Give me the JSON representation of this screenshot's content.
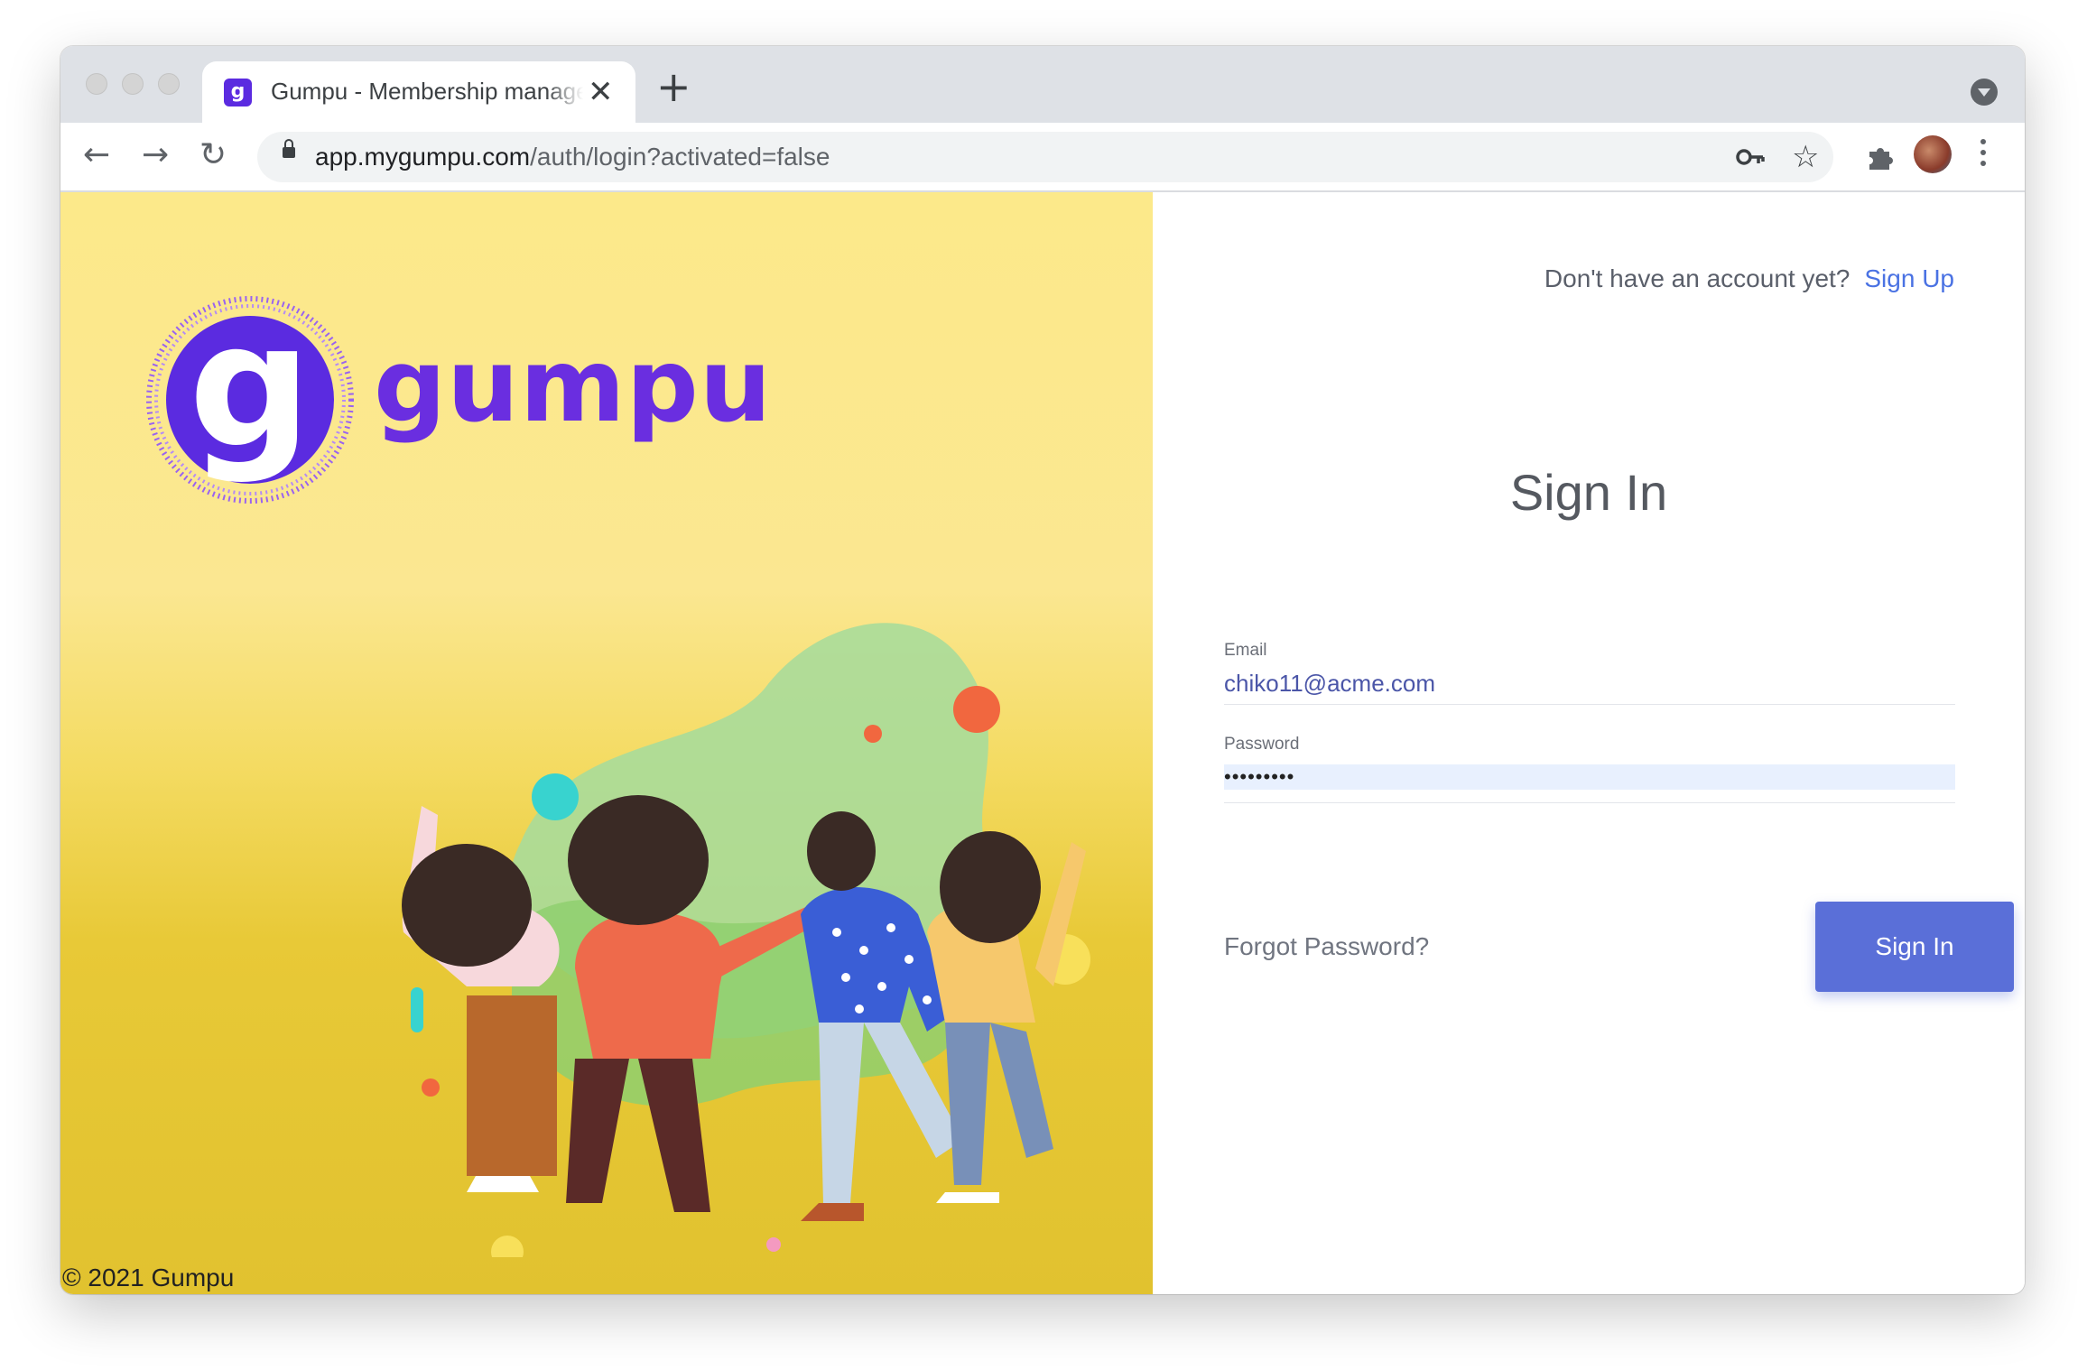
{
  "browser": {
    "tab_title": "Gumpu - Membership management",
    "tab_favicon": "g",
    "new_tab": "+",
    "close_tab": "✕",
    "url_host": "app.mygumpu.com",
    "url_path": "/auth/login?activated=false"
  },
  "icons": {
    "back": "back-arrow-icon",
    "forward": "forward-arrow-icon",
    "reload": "reload-icon",
    "key": "key-icon",
    "star": "star-icon",
    "extensions": "puzzle-icon",
    "menu": "kebab-menu-icon"
  },
  "brand": {
    "logo_letter": "g",
    "name": "gumpu",
    "color": "#6a2ee0",
    "copyright": "© 2021 Gumpu"
  },
  "auth": {
    "signup_prompt": "Don't have an account yet?",
    "signup_link": "Sign Up",
    "heading": "Sign In",
    "email_label": "Email",
    "email_value": "chiko11@acme.com",
    "password_label": "Password",
    "password_value": "•••••••••",
    "forgot_link": "Forgot Password?",
    "submit_label": "Sign In",
    "accent": "#5a6fd8"
  }
}
